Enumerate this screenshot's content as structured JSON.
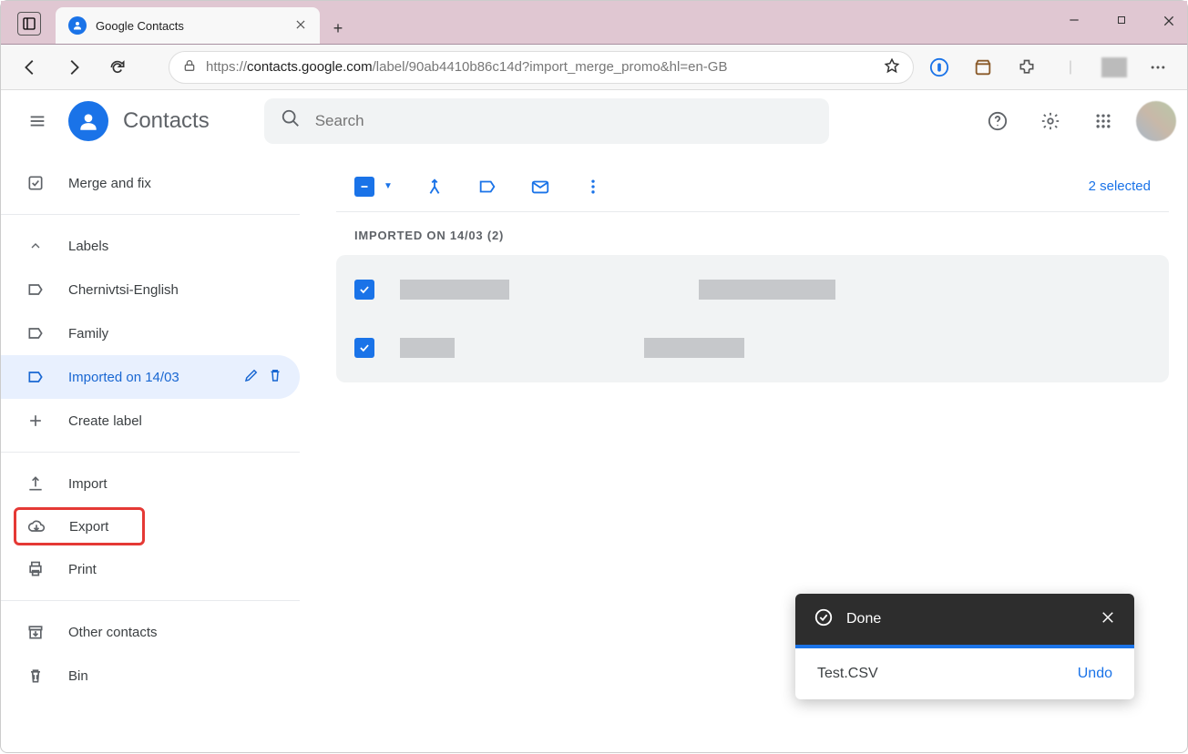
{
  "browser": {
    "tab_title": "Google Contacts",
    "url_prefix": "https://",
    "url_domain": "contacts.google.com",
    "url_path": "/label/90ab4410b86c14d?import_merge_promo&hl=en-GB"
  },
  "app": {
    "title": "Contacts",
    "search_placeholder": "Search"
  },
  "sidebar": {
    "merge_fix": "Merge and fix",
    "labels_header": "Labels",
    "labels": [
      {
        "label": "Chernivtsi-English"
      },
      {
        "label": "Family"
      },
      {
        "label": "Imported on 14/03"
      }
    ],
    "create_label": "Create label",
    "import": "Import",
    "export": "Export",
    "print": "Print",
    "other_contacts": "Other contacts",
    "bin": "Bin"
  },
  "main": {
    "selected_text": "2 selected",
    "list_header": "Imported on 14/03 (2)"
  },
  "toast": {
    "title": "Done",
    "file": "Test.CSV",
    "undo": "Undo"
  }
}
